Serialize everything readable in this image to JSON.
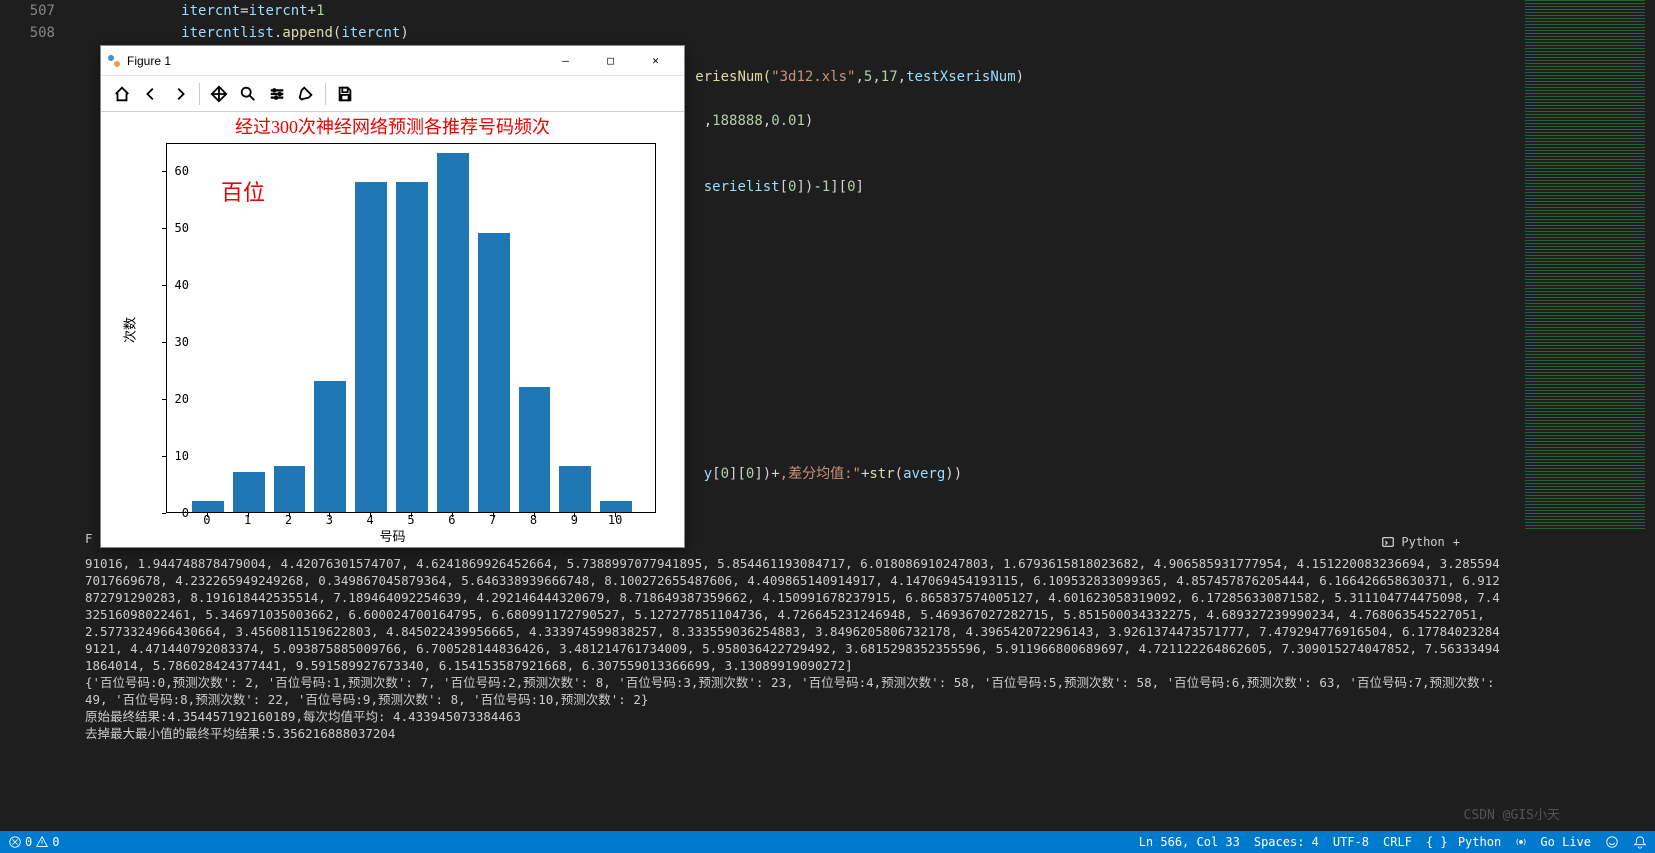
{
  "code": {
    "line_numbers": [
      "507",
      "508",
      "",
      "",
      "",
      "",
      "",
      "",
      ""
    ],
    "l507": "itercnt=itercnt+1",
    "l508": "itercntlist.append(itercnt)",
    "snip1a": "eriesNum(",
    "snip1b": "\"3d12.xls\"",
    "snip1c": ",5,17,testXserisNum)",
    "snip2a": ",188888,0.01)",
    "snip3a": "serielist[0])-1][0]",
    "snip4a": "y[0][0])+\"",
    "snip4b": ",差分均值:\"",
    "snip4c": "+str(averg))"
  },
  "figure": {
    "title": "Figure 1",
    "btn_min": "—",
    "btn_max": "□",
    "btn_close": "✕",
    "chart_title": "经过300次神经网络预测各推荐号码频次",
    "pos_label": "百位",
    "ylabel": "次数",
    "xlabel": "号码"
  },
  "chart_data": {
    "type": "bar",
    "title": "经过300次神经网络预测各推荐号码频次",
    "annotation": "百位",
    "xlabel": "号码",
    "ylabel": "次数",
    "categories": [
      "0",
      "1",
      "2",
      "3",
      "4",
      "5",
      "6",
      "7",
      "8",
      "9",
      "10"
    ],
    "values": [
      2,
      7,
      8,
      23,
      58,
      58,
      63,
      49,
      22,
      8,
      2
    ],
    "ylim": [
      0,
      65
    ],
    "yticks": [
      0,
      10,
      20,
      30,
      40,
      50,
      60
    ]
  },
  "terminal": {
    "text1": "91016, 1.944748878479004, 4.42076301574707, 4.6241869926452664, 5.7388997077941895, 5.854461193084717, 6.018086910247803, 1.6793615818023682, 4.906585931777954, 4.151220083236694, 3.2855947017669678, 4.232265949249268, 0.349867045879364, 5.646338939666748, 8.100272655487606, 4.409865140914917, 4.147069454193115, 6.109532833099365, 4.857457876205444, 6.166426658630371, 6.912872791290283, 8.191618442535514, 7.189464092254639, 4.292146444320679, 8.718649387359662, 4.150991678237915, 6.865837574005127, 4.601623058319092, 6.172856330871582, 5.311104774475098, 7.432516098022461, 5.346971035003662, 6.600024700164795, 6.680991172790527, 5.127277851104736, 4.726645231246948, 5.469367027282715, 5.851500034332275, 4.689327239990234, 4.768063545227051, 2.5773324966430664, 3.4560811519622803, 4.845022439956665, 4.333974599838257, 8.333559036254883, 3.8496205806732178, 4.396542072296143, 3.9261374473571777, 7.479294776916504, 6.177840232849121, 4.471440792083374, 5.093875885009766, 6.700528144836426, 3.481214761734009, 5.958036422729492, 3.6815298352355596, 5.911966800689697, 4.721122264862605, 7.309015274047852, 7.563334941864014, 5.786028424377441, 9.591589927673340, 6.154153587921668, 6.307559013366699, 3.13089919090272]",
    "text2": "{'百位号码:0,预测次数': 2, '百位号码:1,预测次数': 7, '百位号码:2,预测次数': 8, '百位号码:3,预测次数': 23, '百位号码:4,预测次数': 58, '百位号码:5,预测次数': 58, '百位号码:6,预测次数': 63, '百位号码:7,预测次数': 49, '百位号码:8,预测次数': 22, '百位号码:9,预测次数': 8, '百位号码:10,预测次数': 2}",
    "text3": "原始最终结果:4.354457192160189,每次均值平均: 4.433945073384463",
    "text4": "去掉最大最小值的最终平均结果:5.356216888037204",
    "tab_label": "Python",
    "tab_add": "+"
  },
  "statusbar": {
    "errors": "0",
    "warnings": "0",
    "ln_col": "Ln 566, Col 33",
    "spaces": "Spaces: 4",
    "encoding": "UTF-8",
    "eol": "CRLF",
    "lang": "Python",
    "golive": "Go Live",
    "bell": ""
  },
  "watermark": "CSDN @GIS小天"
}
